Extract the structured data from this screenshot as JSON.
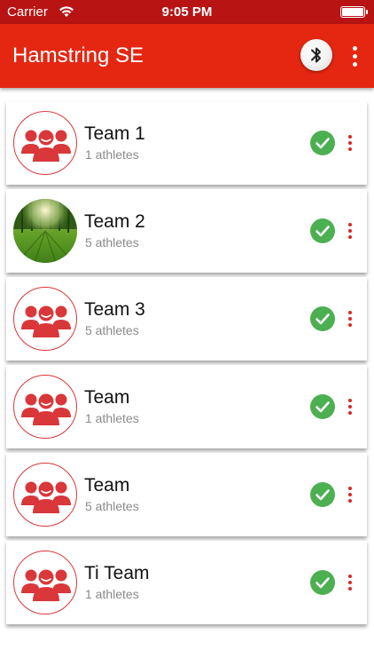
{
  "status_bar": {
    "carrier": "Carrier",
    "time": "9:05 PM",
    "wifi_icon": "wifi-icon",
    "battery_icon": "battery-icon"
  },
  "app_bar": {
    "title": "Hamstring SE",
    "bluetooth_icon": "bluetooth-icon",
    "menu_icon": "more-vertical-icon",
    "color": "#e52711"
  },
  "teams": [
    {
      "name": "Team 1",
      "athletes": "1 athletes",
      "avatar": "team-group-icon",
      "selected": true
    },
    {
      "name": "Team 2",
      "athletes": "5 athletes",
      "avatar": "forest-photo",
      "selected": true
    },
    {
      "name": "Team 3",
      "athletes": "5 athletes",
      "avatar": "team-group-icon",
      "selected": true
    },
    {
      "name": "Team",
      "athletes": "1 athletes",
      "avatar": "team-group-icon",
      "selected": true
    },
    {
      "name": "Team",
      "athletes": "5 athletes",
      "avatar": "team-group-icon",
      "selected": true
    },
    {
      "name": "Ti Team",
      "athletes": "1 athletes",
      "avatar": "team-group-icon",
      "selected": true
    }
  ],
  "colors": {
    "accent": "#e52711",
    "status_bar": "#b81414",
    "check": "#4caf50",
    "kebab": "#d62a2a"
  }
}
